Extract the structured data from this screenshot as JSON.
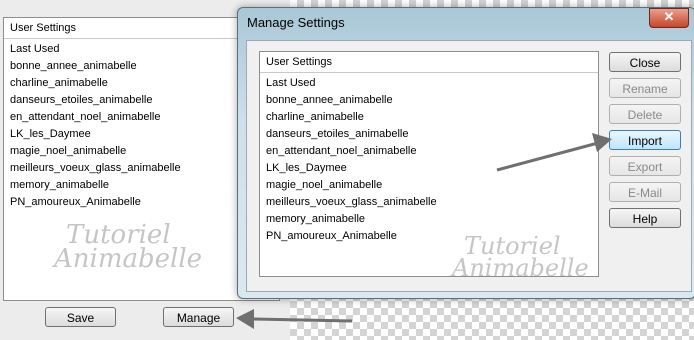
{
  "left_panel": {
    "list_header": "User Settings",
    "items": [
      "Last Used",
      "bonne_annee_animabelle",
      "charline_animabelle",
      "danseurs_etoiles_animabelle",
      "en_attendant_noel_animabelle",
      "LK_les_Daymee",
      "magie_noel_animabelle",
      "meilleurs_voeux_glass_animabelle",
      "memory_animabelle",
      "PN_amoureux_Animabelle"
    ],
    "save_label": "Save",
    "manage_label": "Manage"
  },
  "dialog": {
    "title": "Manage Settings",
    "close_glyph": "✕",
    "list_header": "User Settings",
    "items": [
      "Last Used",
      "bonne_annee_animabelle",
      "charline_animabelle",
      "danseurs_etoiles_animabelle",
      "en_attendant_noel_animabelle",
      "LK_les_Daymee",
      "magie_noel_animabelle",
      "meilleurs_voeux_glass_animabelle",
      "memory_animabelle",
      "PN_amoureux_Animabelle"
    ],
    "buttons": {
      "close": "Close",
      "rename": "Rename",
      "delete": "Delete",
      "import": "Import",
      "export": "Export",
      "email": "E-Mail",
      "help": "Help"
    }
  },
  "watermark": {
    "line1": "Tutoriel",
    "line2": "Animabelle"
  },
  "colors": {
    "arrow": "#6f6f6f",
    "focus_border": "#3c7fb1"
  }
}
